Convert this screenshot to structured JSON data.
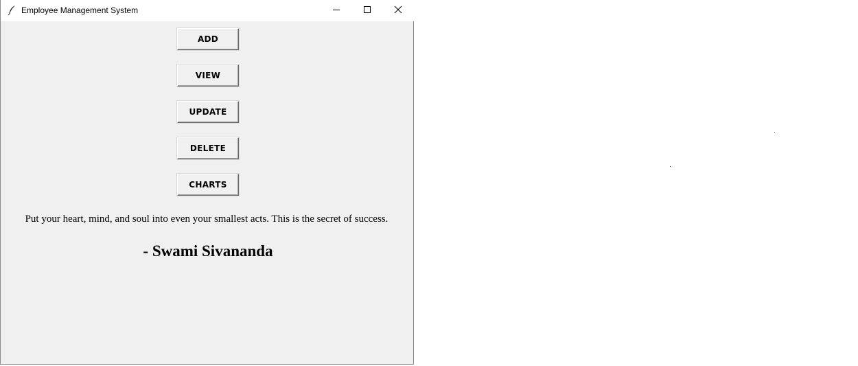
{
  "window": {
    "title": "Employee Management System",
    "app_icon": "feather-icon",
    "controls": [
      "minimize-icon",
      "maximize-icon",
      "close-icon"
    ]
  },
  "menu": {
    "buttons": [
      {
        "label": "ADD"
      },
      {
        "label": "VIEW"
      },
      {
        "label": "UPDATE"
      },
      {
        "label": "DELETE"
      },
      {
        "label": "CHARTS"
      }
    ]
  },
  "quote": {
    "text": "Put your heart, mind, and soul into even your smallest acts. This is the secret of success.",
    "author": "- Swami Sivananda"
  },
  "colors": {
    "window_bg": "#f0f0f0",
    "titlebar_bg": "#ffffff",
    "desktop_bg": "#ffffff"
  }
}
